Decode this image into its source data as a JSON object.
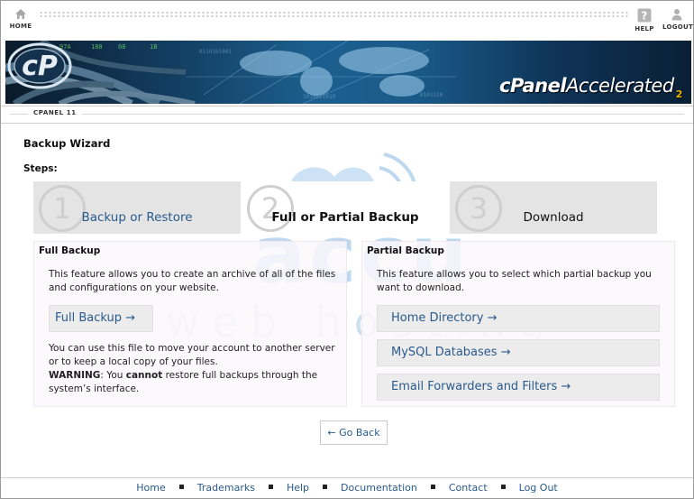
{
  "topbar": {
    "home_label": "HOME",
    "help_label": "HELP",
    "logout_label": "LOGOUT",
    "home_icon": "house-icon",
    "help_icon": "question-icon",
    "logout_icon": "person-icon"
  },
  "banner": {
    "brand": "cPanel",
    "brand_suffix": "Accelerated",
    "brand_version": "2"
  },
  "version_label": "CPANEL 11",
  "page_title": "Backup Wizard",
  "steps_label": "Steps:",
  "steps": [
    {
      "number": "1",
      "label": "Backup or Restore"
    },
    {
      "number": "2",
      "label": "Full or Partial Backup"
    },
    {
      "number": "3",
      "label": "Download"
    }
  ],
  "full_backup": {
    "title": "Full Backup",
    "description": "This feature allows you to create an archive of all of the files and configurations on your website.",
    "button_label": "Full Backup →",
    "note": "You can use this file to move your account to another server or to keep a local copy of your files.",
    "warning_label": "WARNING",
    "warning_pre": ": You ",
    "warning_strong": "cannot",
    "warning_post": " restore full backups through the system’s interface."
  },
  "partial_backup": {
    "title": "Partial Backup",
    "description": "This feature allows you to select which partial backup you want to download.",
    "buttons": [
      {
        "label": "Home Directory →"
      },
      {
        "label": "MySQL Databases →"
      },
      {
        "label": "Email Forwarders and Filters →"
      }
    ]
  },
  "go_back_label": "← Go Back",
  "watermark": {
    "line1": "accu",
    "line2": "web hosting"
  },
  "footer": {
    "links": [
      "Home",
      "Trademarks",
      "Help",
      "Documentation",
      "Contact",
      "Log Out"
    ]
  },
  "colors": {
    "link": "#2a5a8c",
    "step_active_bg": "#ffffff",
    "step_inactive_bg": "#e4e4e4",
    "watermark": "#7fb3e0"
  }
}
